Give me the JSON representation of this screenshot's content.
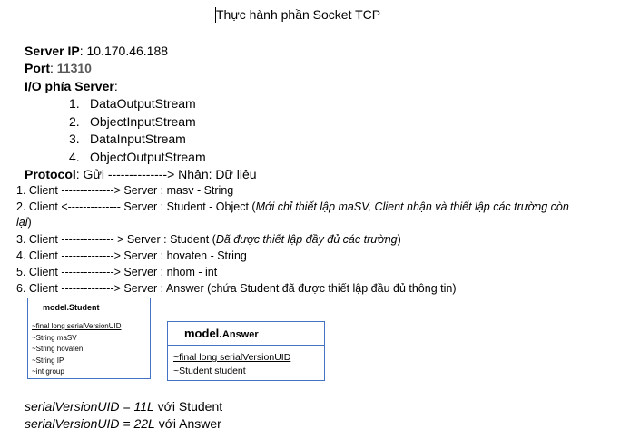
{
  "title": "Thực hành phần Socket TCP",
  "server_ip_label": "Server IP",
  "server_ip_value": ":  10.170.46.188",
  "port_label": "Port",
  "port_colon": ": ",
  "port_value": "11310",
  "io_label": "I/O phía Server",
  "io_colon": ":",
  "streams": [
    {
      "num": "1.",
      "text": "DataOutputStream"
    },
    {
      "num": "2.",
      "text": "ObjectInputStream"
    },
    {
      "num": "3.",
      "text": "DataInputStream"
    },
    {
      "num": "4.",
      "text": "ObjectOutputStream"
    }
  ],
  "protocol_label": "Protocol",
  "protocol_text": ":  Gửi --------------> Nhận: Dữ liệu",
  "steps": [
    {
      "text": "1. Client   --------------> Server : masv  - String",
      "italic": ""
    },
    {
      "text": "2. Client   <-------------- Server : Student - Object (",
      "italic": "Mới chỉ thiết lập maSV, Client nhận và thiết lập các trường còn",
      "after": ""
    },
    {
      "text": "",
      "italic": "lại",
      "after": ")"
    },
    {
      "text": "3. Client   -------------- > Server : Student  (",
      "italic": "Đã được thiết lập đầy đủ các trường",
      "after": ")"
    },
    {
      "text": "4. Client   --------------> Server : hovaten  - String",
      "italic": ""
    },
    {
      "text": "5. Client   --------------> Server : nhom - int",
      "italic": ""
    },
    {
      "text": "6. Client -------------->  Server : Answer (chứa Student đã được thiết lập đầu đủ thông tin)",
      "italic": ""
    }
  ],
  "uml_student": {
    "name": "model.Student",
    "attrs": [
      "~final long serialVersionUID",
      "~String maSV",
      "~String hovaten",
      "~String IP",
      "~int group"
    ]
  },
  "uml_answer": {
    "name_bold": "model.",
    "name_rest": "Answer",
    "attrs": [
      "~final long serialVersionUID",
      "~Student student"
    ]
  },
  "uid_student_italic": "serialVersionUID = 11L",
  "uid_student_rest": " với Student",
  "uid_answer_italic": "serialVersionUID = 22L",
  "uid_answer_rest": " với Answer",
  "colors": {
    "uml_border": "#4472c4",
    "port_value": "#595959"
  }
}
